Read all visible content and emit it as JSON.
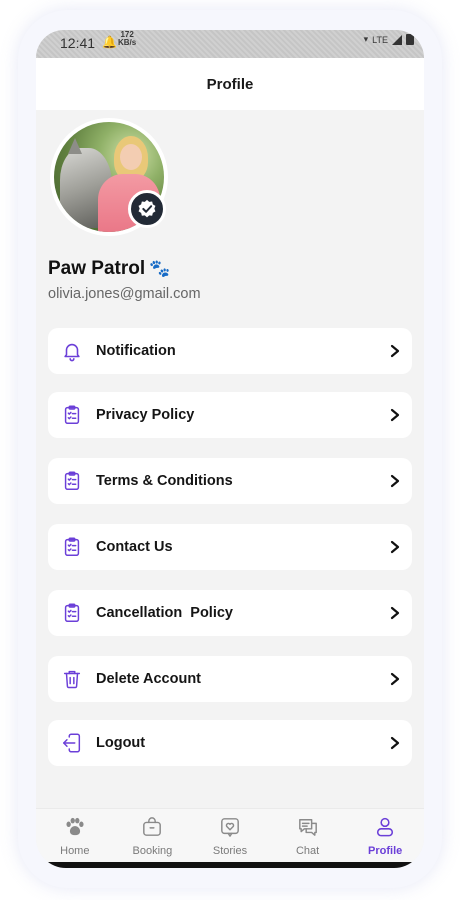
{
  "status_bar": {
    "time": "12:41",
    "speed_value": "172",
    "speed_unit": "KB/s",
    "network": "LTE"
  },
  "header": {
    "title": "Profile"
  },
  "profile": {
    "name": "Paw Patrol",
    "name_emoji": "🐾",
    "email": "olivia.jones@gmail.com"
  },
  "menu": [
    {
      "label": "Notification",
      "icon": "bell-icon"
    },
    {
      "label": "Privacy Policy",
      "icon": "clipboard-list-icon"
    },
    {
      "label": "Terms & Conditions",
      "icon": "clipboard-list-icon"
    },
    {
      "label": "Contact Us",
      "icon": "clipboard-list-icon"
    },
    {
      "label": "Cancellation  Policy",
      "icon": "clipboard-list-icon"
    },
    {
      "label": "Delete Account",
      "icon": "trash-icon"
    },
    {
      "label": "Logout",
      "icon": "logout-icon"
    }
  ],
  "bottom_nav": [
    {
      "label": "Home",
      "icon": "paw-icon",
      "active": false
    },
    {
      "label": "Booking",
      "icon": "bag-icon",
      "active": false
    },
    {
      "label": "Stories",
      "icon": "heart-shield-icon",
      "active": false
    },
    {
      "label": "Chat",
      "icon": "chat-icon",
      "active": false
    },
    {
      "label": "Profile",
      "icon": "user-icon",
      "active": true
    }
  ],
  "colors": {
    "accent": "#6b3fd8",
    "text": "#151515",
    "background": "#f3f3f3"
  }
}
